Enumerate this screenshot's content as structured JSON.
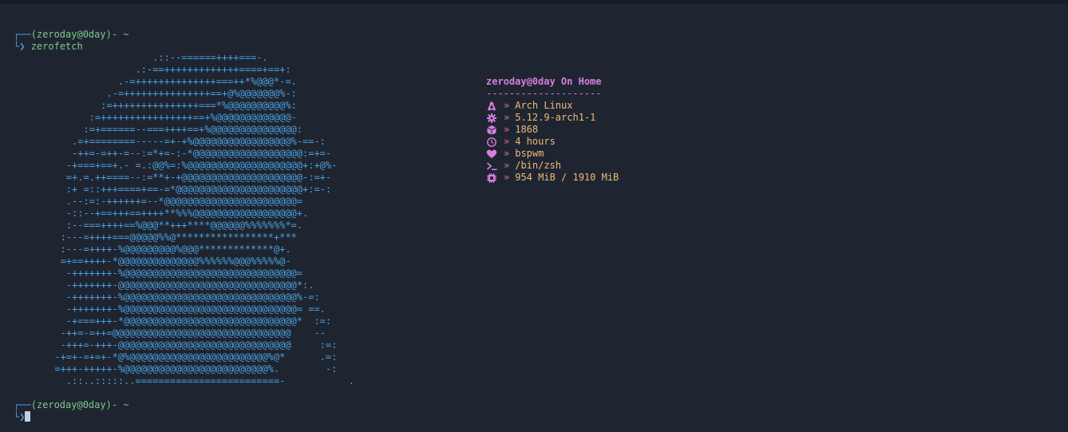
{
  "prompt1": {
    "user_host": "(zeroday@0day)",
    "path": "~",
    "command": "zerofetch"
  },
  "ascii_art": [
    "                       .::--======++++===-.",
    "                    .:-==+++++++++++++====+==+:",
    "                 .-=++++++++++++++===++*%@@@*-=.",
    "               .-=+++++++++++++++==+@%@@@@@@@%-:",
    "              :=+++++++++++++++===*%@@@@@@@@@@%:",
    "            :=++++++++++++++++==+%@@@@@@@@@@@@@-",
    "           :=+======--===++++==+%@@@@@@@@@@@@@@@:",
    "         .=+========-----=+-+%@@@@@@@@@@@@@@@@@%-==-:",
    "         -++=-=++-=--:=*+=-:-*@@@@@@@@@@@@@@@@@@@:=+=-",
    "        -+===+==+.- =.:@@%=:%@@@@@@@@@@@@@@@@@@@@+:+@%-",
    "        =+.=.++====--:=**+-+@@@@@@@@@@@@@@@@@@@@@-:=+-",
    "        :+ =::+++====+==-=*@@@@@@@@@@@@@@@@@@@@@@+:=-:",
    "        .--:=:-++++++=--*@@@@@@@@@@@@@@@@@@@@@@@=",
    "        -::--+==+++==++++**%%%@@@@@@@@@@@@@@@@@@+.",
    "        :--===++++==%@@@**+++****@@@@@@%%%%%%%*=.",
    "       :---=++++===@@@@@%%@*****************+***",
    "       :---=++++-%@@@@@@@@@%@@@*************@+.",
    "       =+==++++-*@@@@@@@@@@@@@@%%%%%%@@@%%%%%@-",
    "        -+++++++-%@@@@@@@@@@@@@@@@@@@@@@@@@@@@@@=",
    "        -+++++++-@@@@@@@@@@@@@@@@@@@@@@@@@@@@@@@*:.",
    "        -+++++++-%@@@@@@@@@@@@@@@@@@@@@@@@@@@@@@%-=:",
    "        -+++++++-%@@@@@@@@@@@@@@@@@@@@@@@@@@@@@@= ==.",
    "        -+===+++-*@@@@@@@@@@@@@@@@@@@@@@@@@@@@@@*  :=:",
    "       -++=-=++=@@@@@@@@@@@@@@@@@@@@@@@@@@@@@@@    --",
    "       -+++=-+++-@@@@@@@@@@@@@@@@@@@@@@@@@@@@@@     :=:",
    "      -+=+-=+=+-*@%@@@@@@@@@@@@@@@@@@@@@@@@%@*      .=:",
    "      =+++-+++++-%@@@@@@@@@@@@@@@@@@@@@@@@@%.        -:",
    "        .::..:::::..=========================-           ."
  ],
  "info": {
    "title": "zeroday@0day On Home",
    "separator": "--------------------",
    "rows": [
      {
        "icon": "tux-icon",
        "arrow": "»",
        "value": "Arch Linux"
      },
      {
        "icon": "gear-icon",
        "arrow": "»",
        "value": "5.12.9-arch1-1"
      },
      {
        "icon": "package-icon",
        "arrow": "»",
        "value": "1868"
      },
      {
        "icon": "clock-icon",
        "arrow": "»",
        "value": "4 hours"
      },
      {
        "icon": "heart-icon",
        "arrow": "»",
        "value": "bspwm"
      },
      {
        "icon": "terminal-icon",
        "arrow": "»",
        "value": "/bin/zsh"
      },
      {
        "icon": "memory-icon",
        "arrow": "»",
        "value": "954 MiB / 1910 MiB"
      }
    ]
  },
  "prompt2": {
    "user_host": "(zeroday@0day)",
    "path": "~"
  },
  "colors": {
    "background": "#1f2530",
    "prompt_green": "#7dc98a",
    "corner_blue": "#4a9ad8",
    "art_blue": "#4aa0e0",
    "title_magenta": "#d67ee0",
    "arrow_pink": "#e06c95",
    "value_orange": "#eeb87a"
  }
}
